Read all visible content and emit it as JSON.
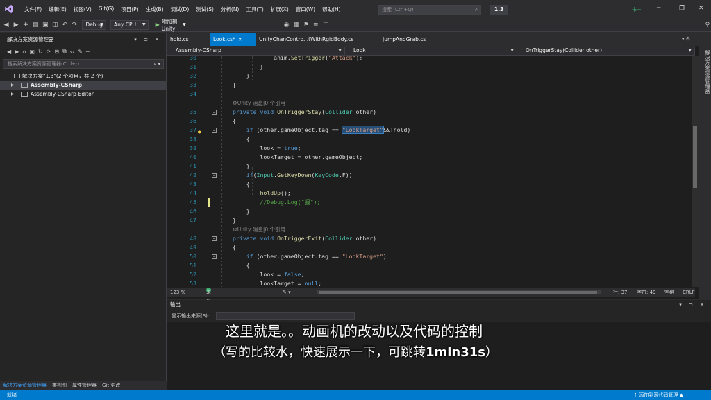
{
  "titlebar": {
    "menu": [
      "文件(F)",
      "编辑(E)",
      "视图(V)",
      "Git(G)",
      "项目(P)",
      "生成(B)",
      "调试(D)",
      "测试(S)",
      "分析(N)",
      "工具(T)",
      "扩展(X)",
      "窗口(W)",
      "帮助(H)"
    ],
    "search_placeholder": "搜索 (Ctrl+Q)",
    "solution_name": "1.3",
    "user": "卡丰"
  },
  "toolbar": {
    "config": "Debug",
    "platform": "Any CPU",
    "run_label": "附加到 Unity"
  },
  "solution_explorer": {
    "title": "解决方案资源管理器",
    "search_placeholder": "搜索解决方案资源管理器(Ctrl+;)",
    "root": "解决方案\"1.3\"(2 个项目，共 2 个)",
    "projects": [
      "Assembly-CSharp",
      "Assembly-CSharp-Editor"
    ],
    "bottom_tabs": [
      "解决方案资源管理器",
      "类视图",
      "属性管理器",
      "Git 更改"
    ]
  },
  "editor": {
    "tabs": [
      {
        "label": "hold.cs",
        "active": false
      },
      {
        "label": "Look.cs*",
        "active": true
      },
      {
        "label": "UnityChanContro...tWithRgidBody.cs",
        "active": false
      },
      {
        "label": "JumpAndGrab.cs",
        "active": false
      }
    ],
    "nav": {
      "project": "Assembly-CSharp",
      "class": "Look",
      "member": "OnTriggerStay(Collider other)"
    },
    "right_rail": "解决方案资源管理器",
    "status": {
      "zoom": "123 %",
      "issues": "未找到相关问题",
      "line": "行: 37",
      "char": "字符: 49",
      "ws": "空格",
      "eol": "CRLF"
    },
    "lines": [
      {
        "n": "30",
        "code": "            anim.SetTrigger(\"Attack\");"
      },
      {
        "n": "31",
        "code": "        }"
      },
      {
        "n": "32",
        "code": "    }"
      },
      {
        "n": "33",
        "code": "}"
      },
      {
        "n": "34",
        "code": ""
      },
      {
        "n": "",
        "code": "⚙Unity 消息|0 个引用"
      },
      {
        "n": "35",
        "code": "private void OnTriggerStay(Collider other)"
      },
      {
        "n": "36",
        "code": "{"
      },
      {
        "n": "37",
        "code": "    if (other.gameObject.tag == \"LookTarget\"&&!hold)"
      },
      {
        "n": "38",
        "code": "    {"
      },
      {
        "n": "39",
        "code": "        look = true;"
      },
      {
        "n": "40",
        "code": "        lookTarget = other.gameObject;"
      },
      {
        "n": "41",
        "code": "    }"
      },
      {
        "n": "42",
        "code": "    if(Input.GetKeyDown(KeyCode.F))"
      },
      {
        "n": "43",
        "code": "    {"
      },
      {
        "n": "44",
        "code": "        holdUp();"
      },
      {
        "n": "45",
        "code": "        //Debug.Log(\"握\");"
      },
      {
        "n": "46",
        "code": "    }"
      },
      {
        "n": "47",
        "code": "}"
      },
      {
        "n": "",
        "code": "⚙Unity 消息|0 个引用"
      },
      {
        "n": "48",
        "code": "private void OnTriggerExit(Collider other)"
      },
      {
        "n": "49",
        "code": "{"
      },
      {
        "n": "50",
        "code": "    if (other.gameObject.tag == \"LookTarget\")"
      },
      {
        "n": "51",
        "code": "    {"
      },
      {
        "n": "52",
        "code": "        look = false;"
      },
      {
        "n": "53",
        "code": "        lookTarget = null;"
      }
    ]
  },
  "output": {
    "title": "输出",
    "source_label": "显示输出来源(S):"
  },
  "subtitle": {
    "line1": "这里就是。。动画机的改动以及代码的控制",
    "line2_prefix": "（写的比较水，快速展示一下，可跳转",
    "line2_bold": "1min31s",
    "line2_suffix": "）"
  },
  "statusbar": {
    "left": "就绪",
    "right": "↑ 添加到源代码管理 ▲"
  }
}
